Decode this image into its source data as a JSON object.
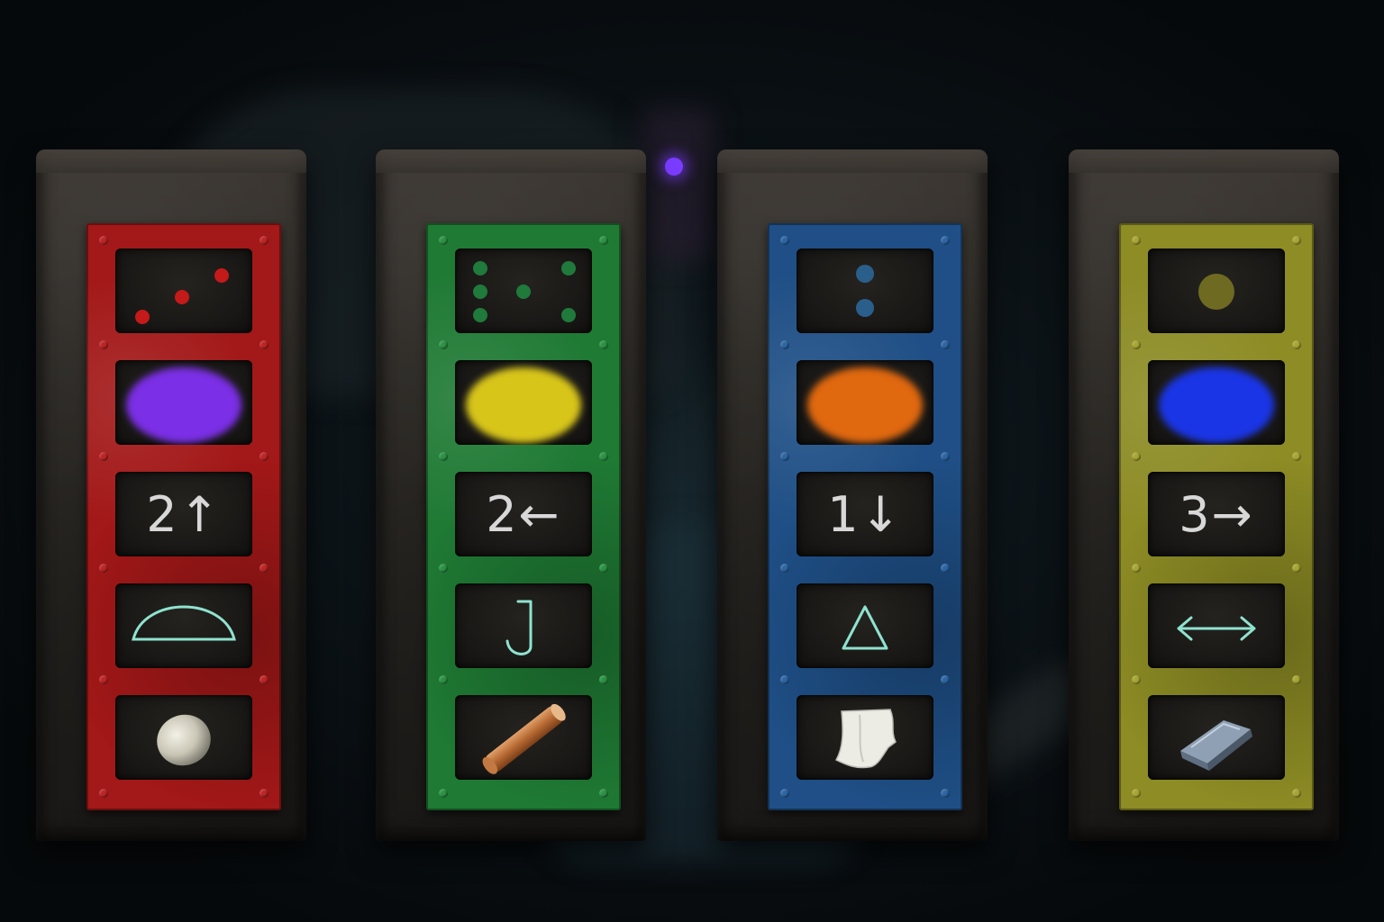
{
  "colors": {
    "red_frame": "#a31818",
    "green_frame": "#1f7a34",
    "blue_frame": "#1f4f86",
    "yellow_frame": "#8d8c25",
    "rune_stroke": "#8fe3cf",
    "chalk_text": "#d8d8d8"
  },
  "pillars": [
    {
      "frame_color": "#a31818",
      "rivet_color": "#c02424",
      "dots": {
        "count": 3,
        "color": "#c41a1a",
        "icon": "dice-three-icon"
      },
      "color_swatch": {
        "color": "#7b2fe6",
        "name": "purple"
      },
      "move": {
        "text": "2↑"
      },
      "rune": {
        "icon": "semicircle-rune-icon"
      },
      "item": {
        "icon": "stone-icon"
      }
    },
    {
      "frame_color": "#1f7a34",
      "rivet_color": "#2a9444",
      "dots": {
        "count": 6,
        "color": "#1f7a3c",
        "icon": "dice-six-icon"
      },
      "color_swatch": {
        "color": "#d8c51a",
        "name": "yellow"
      },
      "move": {
        "text": "2←"
      },
      "rune": {
        "icon": "j-hook-rune-icon"
      },
      "item": {
        "icon": "wooden-stick-icon"
      }
    },
    {
      "frame_color": "#1f4f86",
      "rivet_color": "#2c66a6",
      "dots": {
        "count": 2,
        "color": "#2a5f8c",
        "icon": "dice-two-icon"
      },
      "color_swatch": {
        "color": "#e0680f",
        "name": "orange"
      },
      "move": {
        "text": "1↓"
      },
      "rune": {
        "icon": "triangle-rune-icon"
      },
      "item": {
        "icon": "cloth-icon"
      }
    },
    {
      "frame_color": "#8d8c25",
      "rivet_color": "#a9a732",
      "dots": {
        "count": 1,
        "color": "#6f6a22",
        "icon": "dice-one-icon"
      },
      "color_swatch": {
        "color": "#1a35e6",
        "name": "blue"
      },
      "move": {
        "text": "3→"
      },
      "rune": {
        "icon": "double-arrow-rune-icon"
      },
      "item": {
        "icon": "metal-ingot-icon"
      }
    }
  ]
}
